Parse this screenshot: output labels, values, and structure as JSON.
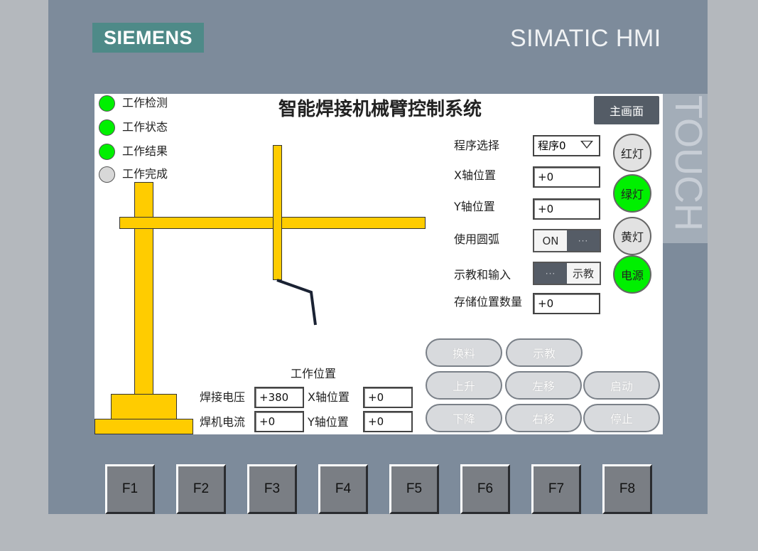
{
  "device": {
    "brand": "SIEMENS",
    "model": "SIMATIC HMI",
    "touch_label": "TOUCH"
  },
  "colors": {
    "bezel": "#7d8b9b",
    "led_on": "#00f000",
    "arm": "#ffcc00",
    "brand_bg": "#4e8a88"
  },
  "screen": {
    "title": "智能焊接机械臂控制系统",
    "main_button": "主画面",
    "status": [
      {
        "label": "工作检测",
        "state": "on"
      },
      {
        "label": "工作状态",
        "state": "on"
      },
      {
        "label": "工作结果",
        "state": "on"
      },
      {
        "label": "工作完成",
        "state": "off"
      }
    ],
    "program_select": {
      "label": "程序选择",
      "value": "程序0"
    },
    "x_position": {
      "label": "X轴位置",
      "value": "+0"
    },
    "y_position": {
      "label": "Y轴位置",
      "value": "+0"
    },
    "use_arc": {
      "label": "使用圆弧",
      "on_text": "ON",
      "handle": "···"
    },
    "teach_input": {
      "label": "示教和输入",
      "handle": "···",
      "state_text": "示教"
    },
    "stored_count": {
      "label": "存储位置数量",
      "value": "+0"
    },
    "lamps": [
      {
        "label": "红灯",
        "state": "off"
      },
      {
        "label": "绿灯",
        "state": "on"
      },
      {
        "label": "黄灯",
        "state": "off"
      },
      {
        "label": "电源",
        "state": "on"
      }
    ],
    "work_position": {
      "title": "工作位置",
      "weld_voltage": {
        "label": "焊接电压",
        "value": "+380"
      },
      "weld_current": {
        "label": "焊机电流",
        "value": "+0"
      },
      "x_pos": {
        "label": "X轴位置",
        "value": "+0"
      },
      "y_pos": {
        "label": "Y轴位置",
        "value": "+0"
      }
    },
    "buttons": {
      "change_material": "换料",
      "teach": "示教",
      "up": "上升",
      "left": "左移",
      "start": "启动",
      "down": "下降",
      "right": "右移",
      "stop": "停止"
    }
  },
  "function_keys": [
    "F1",
    "F2",
    "F3",
    "F4",
    "F5",
    "F6",
    "F7",
    "F8"
  ]
}
